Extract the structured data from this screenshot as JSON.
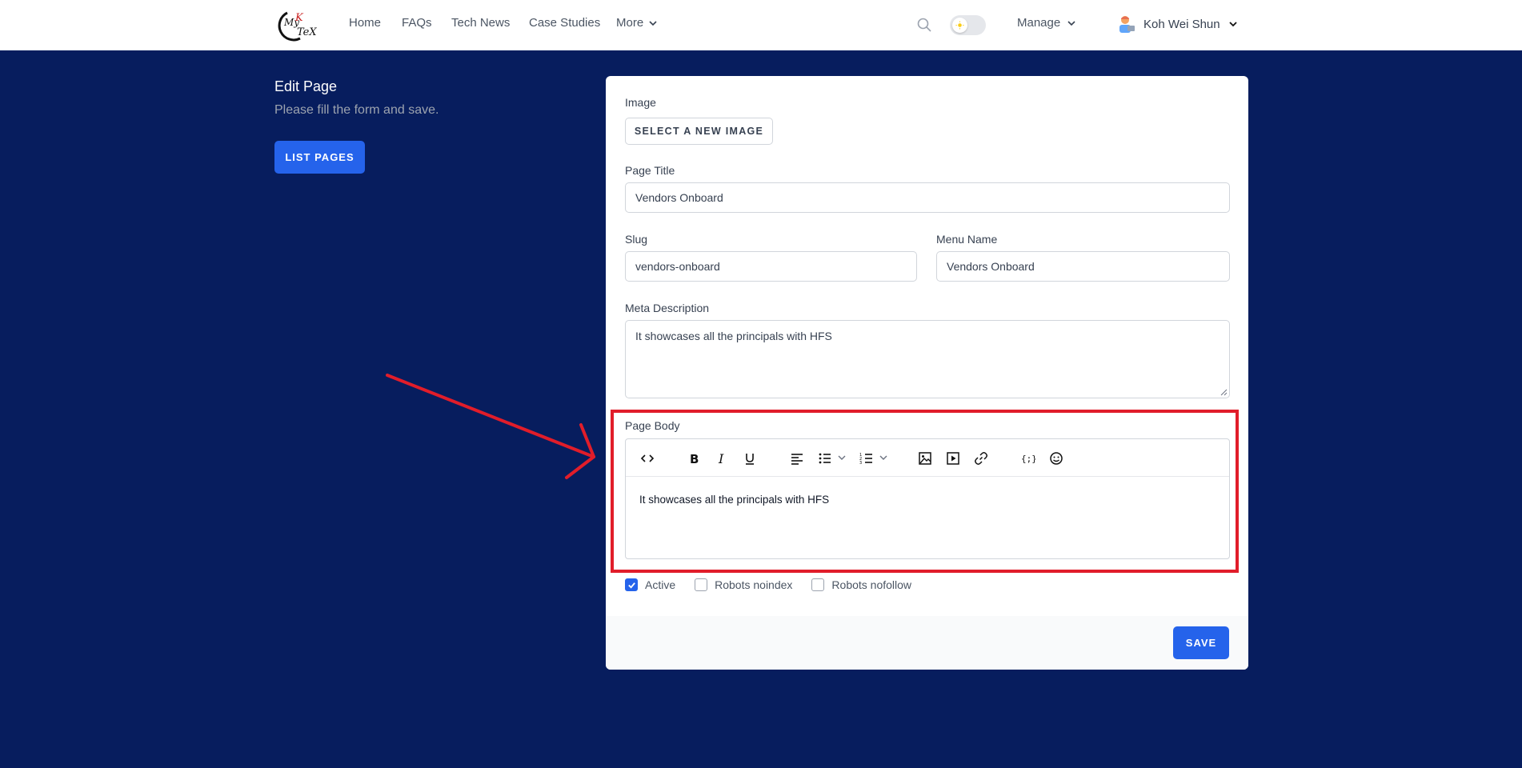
{
  "nav": {
    "logo_alt": "MyKTeX",
    "links": [
      "Home",
      "FAQs",
      "Tech News",
      "Case Studies"
    ],
    "more_label": "More",
    "manage_label": "Manage",
    "user_name": "Koh Wei Shun"
  },
  "sidebar": {
    "title": "Edit Page",
    "subtitle": "Please fill the form and save.",
    "list_button": "LIST PAGES"
  },
  "form": {
    "image_label": "Image",
    "select_image_button": "SELECT A NEW IMAGE",
    "page_title_label": "Page Title",
    "page_title_value": "Vendors Onboard",
    "slug_label": "Slug",
    "slug_value": "vendors-onboard",
    "menu_name_label": "Menu Name",
    "menu_name_value": "Vendors Onboard",
    "meta_label": "Meta Description",
    "meta_value": "It showcases all the principals with HFS",
    "body_label": "Page Body",
    "body_value": "It showcases all the principals with HFS",
    "checkboxes": [
      {
        "label": "Active",
        "checked": true
      },
      {
        "label": "Robots noindex",
        "checked": false
      },
      {
        "label": "Robots nofollow",
        "checked": false
      }
    ],
    "save_button": "SAVE"
  },
  "colors": {
    "background": "#071d5e",
    "primary": "#2563eb",
    "highlight": "#e11d2a"
  }
}
